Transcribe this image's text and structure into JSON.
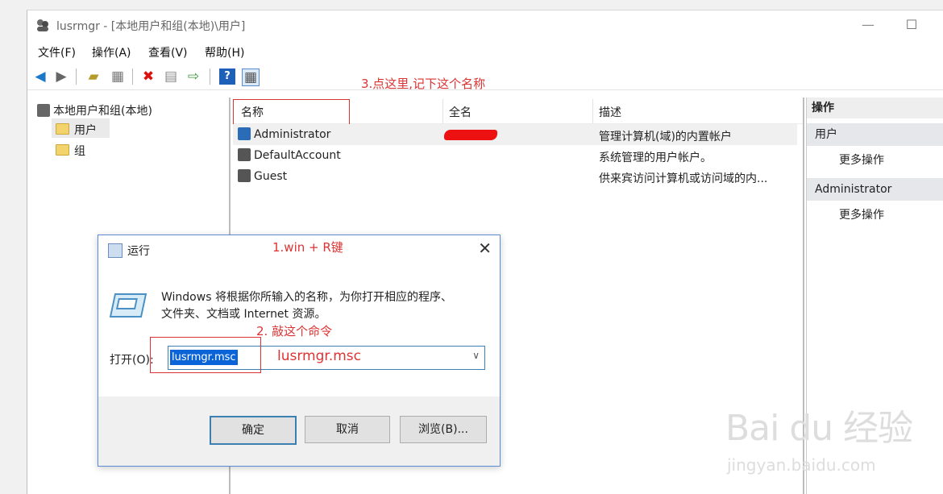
{
  "window": {
    "title": "lusrmgr - [本地用户和组(本地)\\用户]",
    "minimize": "—",
    "maximize": "☐"
  },
  "menu": [
    "文件(F)",
    "操作(A)",
    "查看(V)",
    "帮助(H)"
  ],
  "annotations": {
    "step3": "3.点这里,记下这个名称",
    "step1": "1.win + R键",
    "step2": "2. 敲这个命令",
    "cmd_hint": "lusrmgr.msc"
  },
  "tree": {
    "root": "本地用户和组(本地)",
    "users": "用户",
    "groups": "组"
  },
  "list": {
    "columns": [
      "名称",
      "全名",
      "描述"
    ],
    "rows": [
      {
        "name": "Administrator",
        "desc": "管理计算机(域)的内置帐户"
      },
      {
        "name": "DefaultAccount",
        "desc": "系统管理的用户帐户。"
      },
      {
        "name": "Guest",
        "desc": "供来宾访问计算机或访问域的内..."
      }
    ]
  },
  "actions": {
    "title": "操作",
    "sec1": "用户",
    "more1": "更多操作",
    "sec2": "Administrator",
    "more2": "更多操作"
  },
  "run_dialog": {
    "title": "运行",
    "desc_line1": "Windows 将根据你所输入的名称，为你打开相应的程序、",
    "desc_line2": "文件夹、文档或 Internet 资源。",
    "open_label": "打开(O):",
    "input_value": "lusrmgr.msc",
    "ok": "确定",
    "cancel": "取消",
    "browse": "浏览(B)..."
  },
  "watermark": {
    "logo": "Bai du 经验",
    "url": "jingyan.baidu.com"
  }
}
